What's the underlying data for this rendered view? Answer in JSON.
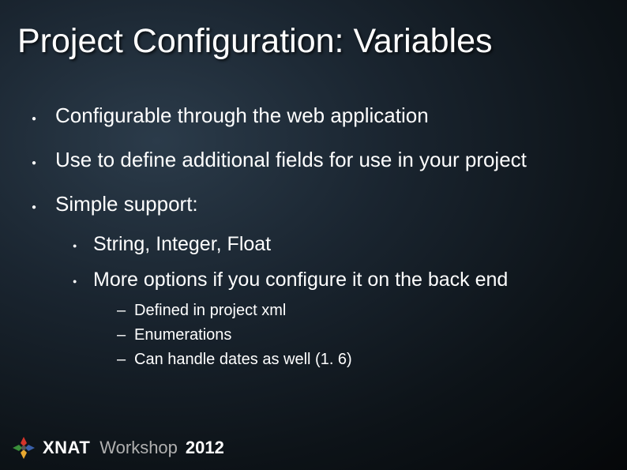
{
  "title": "Project Configuration: Variables",
  "bullets": {
    "b1": "Configurable through the web application",
    "b2": "Use to define additional fields for use in your project",
    "b3": "Simple support:",
    "b3_1": "String, Integer, Float",
    "b3_2": "More options if you configure it on the back end",
    "b3_2_1": "Defined in project xml",
    "b3_2_2": "Enumerations",
    "b3_2_3": "Can handle dates as well (1. 6)"
  },
  "footer": {
    "brand": "XNAT",
    "workshop": "Workshop",
    "year": "2012"
  }
}
